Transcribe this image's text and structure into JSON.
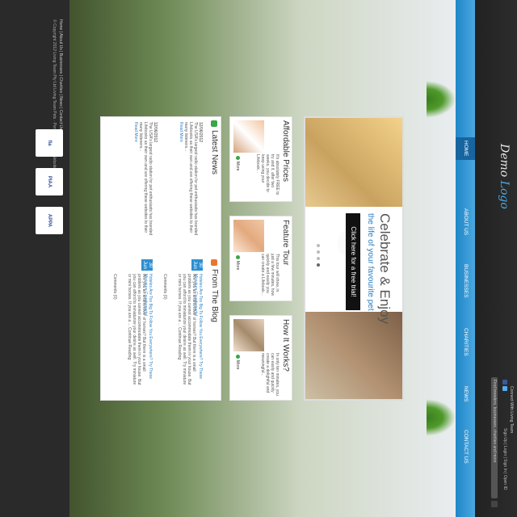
{
  "header": {
    "contact": "Connect With Living Team",
    "login": "Sign Up  |  Login  |  Sign In  |  Open ID",
    "search_placeholder": "Find breeders, businesses, charities and more"
  },
  "logo": {
    "part1": "Demo",
    "part2": "Logo"
  },
  "nav": {
    "items": [
      {
        "label": "HOME"
      },
      {
        "label": "ABOUT US"
      },
      {
        "label": "BUSINESSES"
      },
      {
        "label": "CHARITIES"
      },
      {
        "label": "NEWS"
      },
      {
        "label": "CONTACT US"
      }
    ]
  },
  "hero": {
    "title": "Celebrate & Enjoy",
    "tagline": "the life of your favourite pet",
    "cta": "Click here for a free trial!"
  },
  "boxes": [
    {
      "title": "How It Works?",
      "text": "In only ten minutes, you can easily and quickly create a delightful and meaningful...",
      "more": "More"
    },
    {
      "title": "Feature Tour",
      "text": "This tour will show, in just a few minutes, how quickly and easily you can create a Lifebook...",
      "more": "More"
    },
    {
      "title": "Affordable Prices",
      "text": "It's absolutely FREE to try and if, after two weeks, you decide to keep using your Lifebook...",
      "more": "More"
    }
  ],
  "blog": {
    "heading": "From The Blog",
    "posts": [
      {
        "day": "30",
        "month": "Jun",
        "title": "Hoteles Are Too Big To Follow You Everywhere? Try These Miniature Counterparts!",
        "excerpt": "Are you an ardent lover of horses? But there is a small problem as you cannot accommodate them in your house. But you can afford to miniaturize your desire as well. Try miniature or mini horses. If you are a ... Continue Reading",
        "meta": "Comments (0)"
      },
      {
        "day": "30",
        "month": "Jun",
        "title": "Hoteles Are Too Big To Follow You Everywhere? Try These Miniature Counterparts!",
        "excerpt": "Are you an ardent lover of horses? But there is a small problem as you cannot accommodate them in your house. But you can afford to miniaturize your desire as well. Try miniature or mini horses. If you are a ... Continue Reading",
        "meta": "Comments (0)"
      }
    ]
  },
  "news": {
    "heading": "Latest News",
    "items": [
      {
        "date": "12/06/2012",
        "text": "The USA's largest radio station for pet enthusiasts has branded Lifebooks as their own and are offering these websites to their many listeners...",
        "more": "Read More"
      },
      {
        "date": "12/06/2012",
        "text": "The USA's largest radio station for pet enthusiasts has branded Lifebooks as their own and are offering these websites to their many listeners...",
        "more": "Read More"
      }
    ]
  },
  "footer": {
    "links": "Home  |  About Us  |  Businesses  |  Charities  |  News  |  Contact Us",
    "copyright": "© Copyright 2012 Living Team Pty Ltd Living Team Pets · Personalised Pet Websites",
    "badges": [
      "APPA",
      "PIAA",
      "fia"
    ]
  },
  "colors": {
    "accent": "#2d8fd1",
    "nav": "#1f86c8",
    "green": "#3aa646"
  }
}
